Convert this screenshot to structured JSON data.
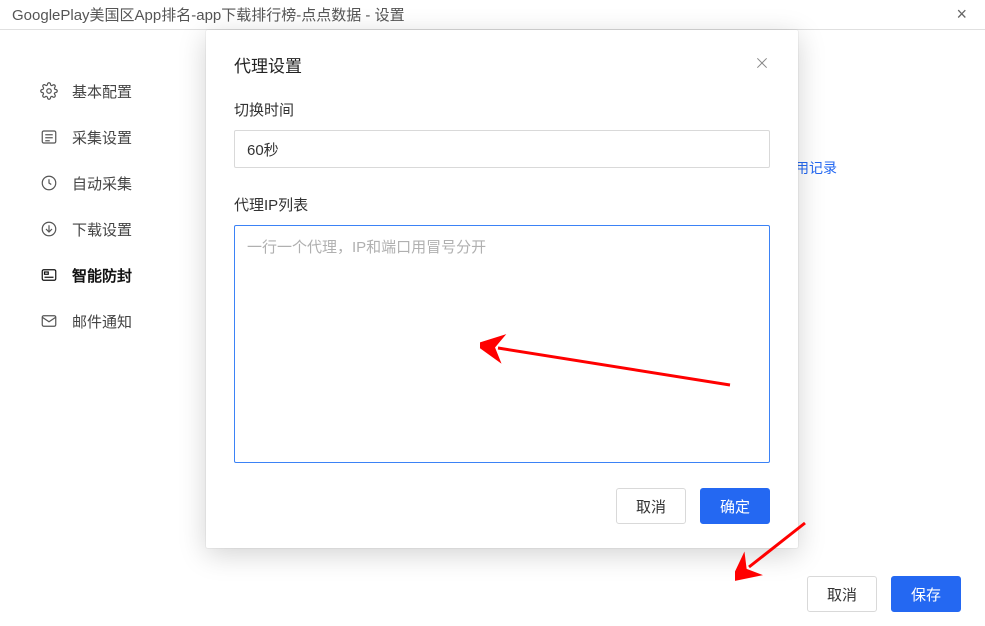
{
  "window": {
    "title": "GooglePlay美国区App排名-app下载排行榜-点点数据 - 设置"
  },
  "sidebar": {
    "items": [
      {
        "label": "基本配置",
        "icon": "gear-icon"
      },
      {
        "label": "采集设置",
        "icon": "list-icon"
      },
      {
        "label": "自动采集",
        "icon": "refresh-icon"
      },
      {
        "label": "下载设置",
        "icon": "download-icon"
      },
      {
        "label": "智能防封",
        "icon": "shield-icon",
        "active": true
      },
      {
        "label": "邮件通知",
        "icon": "mail-icon"
      }
    ]
  },
  "background": {
    "link_text": "用记录",
    "cancel_label": "取消",
    "save_label": "保存"
  },
  "modal": {
    "title": "代理设置",
    "switch_time_label": "切换时间",
    "switch_time_value": "60秒",
    "proxy_list_label": "代理IP列表",
    "proxy_list_placeholder": "一行一个代理，IP和端口用冒号分开",
    "proxy_list_value": "",
    "cancel_label": "取消",
    "confirm_label": "确定"
  }
}
